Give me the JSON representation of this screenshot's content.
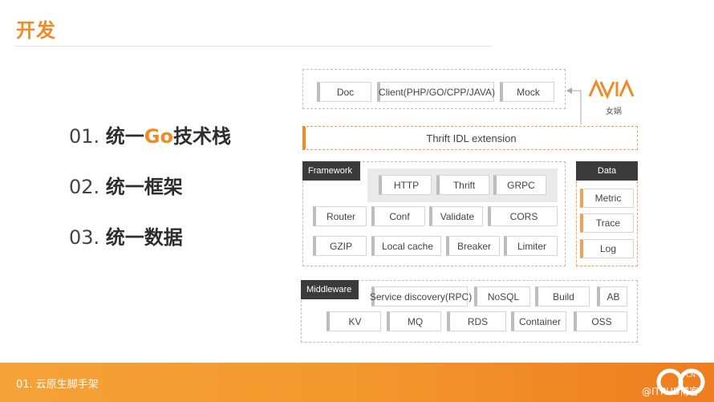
{
  "slide": {
    "title": "开发",
    "points": [
      {
        "num": "01. ",
        "text_before": "统一",
        "highlight": "Go",
        "text_after": "技术栈"
      },
      {
        "num": "02. ",
        "text": "统一框架"
      },
      {
        "num": "03. ",
        "text": "统一数据"
      }
    ],
    "footer_label": "01. 云原生脚手架",
    "footer_logo_text": "CN",
    "watermark": "@ITPUB博客"
  },
  "diagram": {
    "top_boxes": [
      "Doc",
      "Client(PHP/GO/CPP/JAVA)",
      "Mock"
    ],
    "logo_caption": "女娲",
    "idl": "Thrift IDL extension",
    "framework": {
      "label": "Framework",
      "protocols": [
        "HTTP",
        "Thrift",
        "GRPC"
      ],
      "row1": [
        "Router",
        "Conf",
        "Validate",
        "CORS"
      ],
      "row2": [
        "GZIP",
        "Local cache",
        "Breaker",
        "Limiter"
      ]
    },
    "data": {
      "label": "Data",
      "items": [
        "Metric",
        "Trace",
        "Log"
      ]
    },
    "middleware": {
      "label": "Middleware",
      "row1": [
        "Service discovery(RPC)",
        "NoSQL",
        "Build",
        "AB"
      ],
      "row2": [
        "KV",
        "MQ",
        "RDS",
        "Container",
        "OSS"
      ]
    },
    "colors": {
      "accent": "#f08a24",
      "dark_label": "#3b3b3b",
      "border": "#bdbdbd"
    }
  }
}
